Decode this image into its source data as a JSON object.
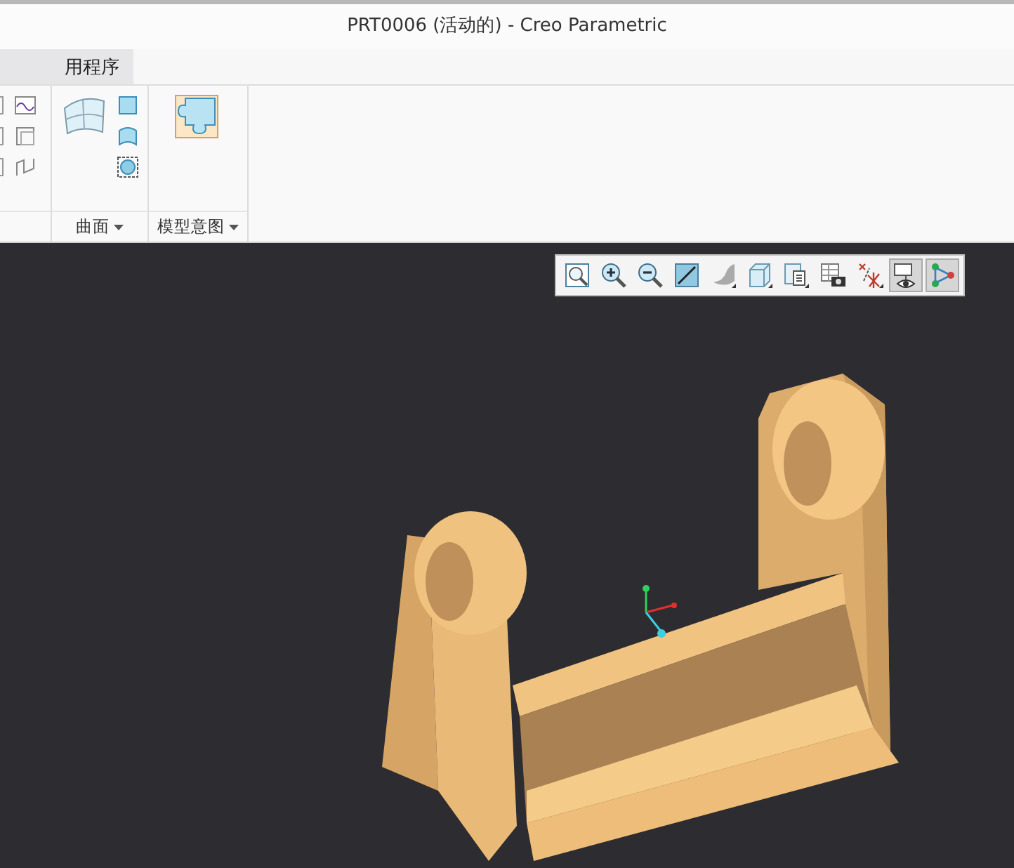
{
  "window": {
    "title": "PRT0006 (活动的) - Creo Parametric"
  },
  "tabs": [
    {
      "label": "用程序",
      "selected": true
    }
  ],
  "ribbon": {
    "groups": [
      {
        "kind": "partial"
      },
      {
        "kind": "surface",
        "label": "曲面",
        "has_menu": true
      },
      {
        "kind": "intent",
        "label": "模型意图",
        "has_menu": true
      }
    ]
  },
  "view_toolbar": [
    {
      "pressed": false
    },
    {
      "pressed": false
    },
    {
      "pressed": false
    },
    {
      "pressed": false
    },
    {
      "pressed": false
    },
    {
      "pressed": false
    },
    {
      "pressed": false
    },
    {
      "pressed": false
    },
    {
      "pressed": false
    },
    {
      "pressed": true
    },
    {
      "pressed": true
    }
  ]
}
